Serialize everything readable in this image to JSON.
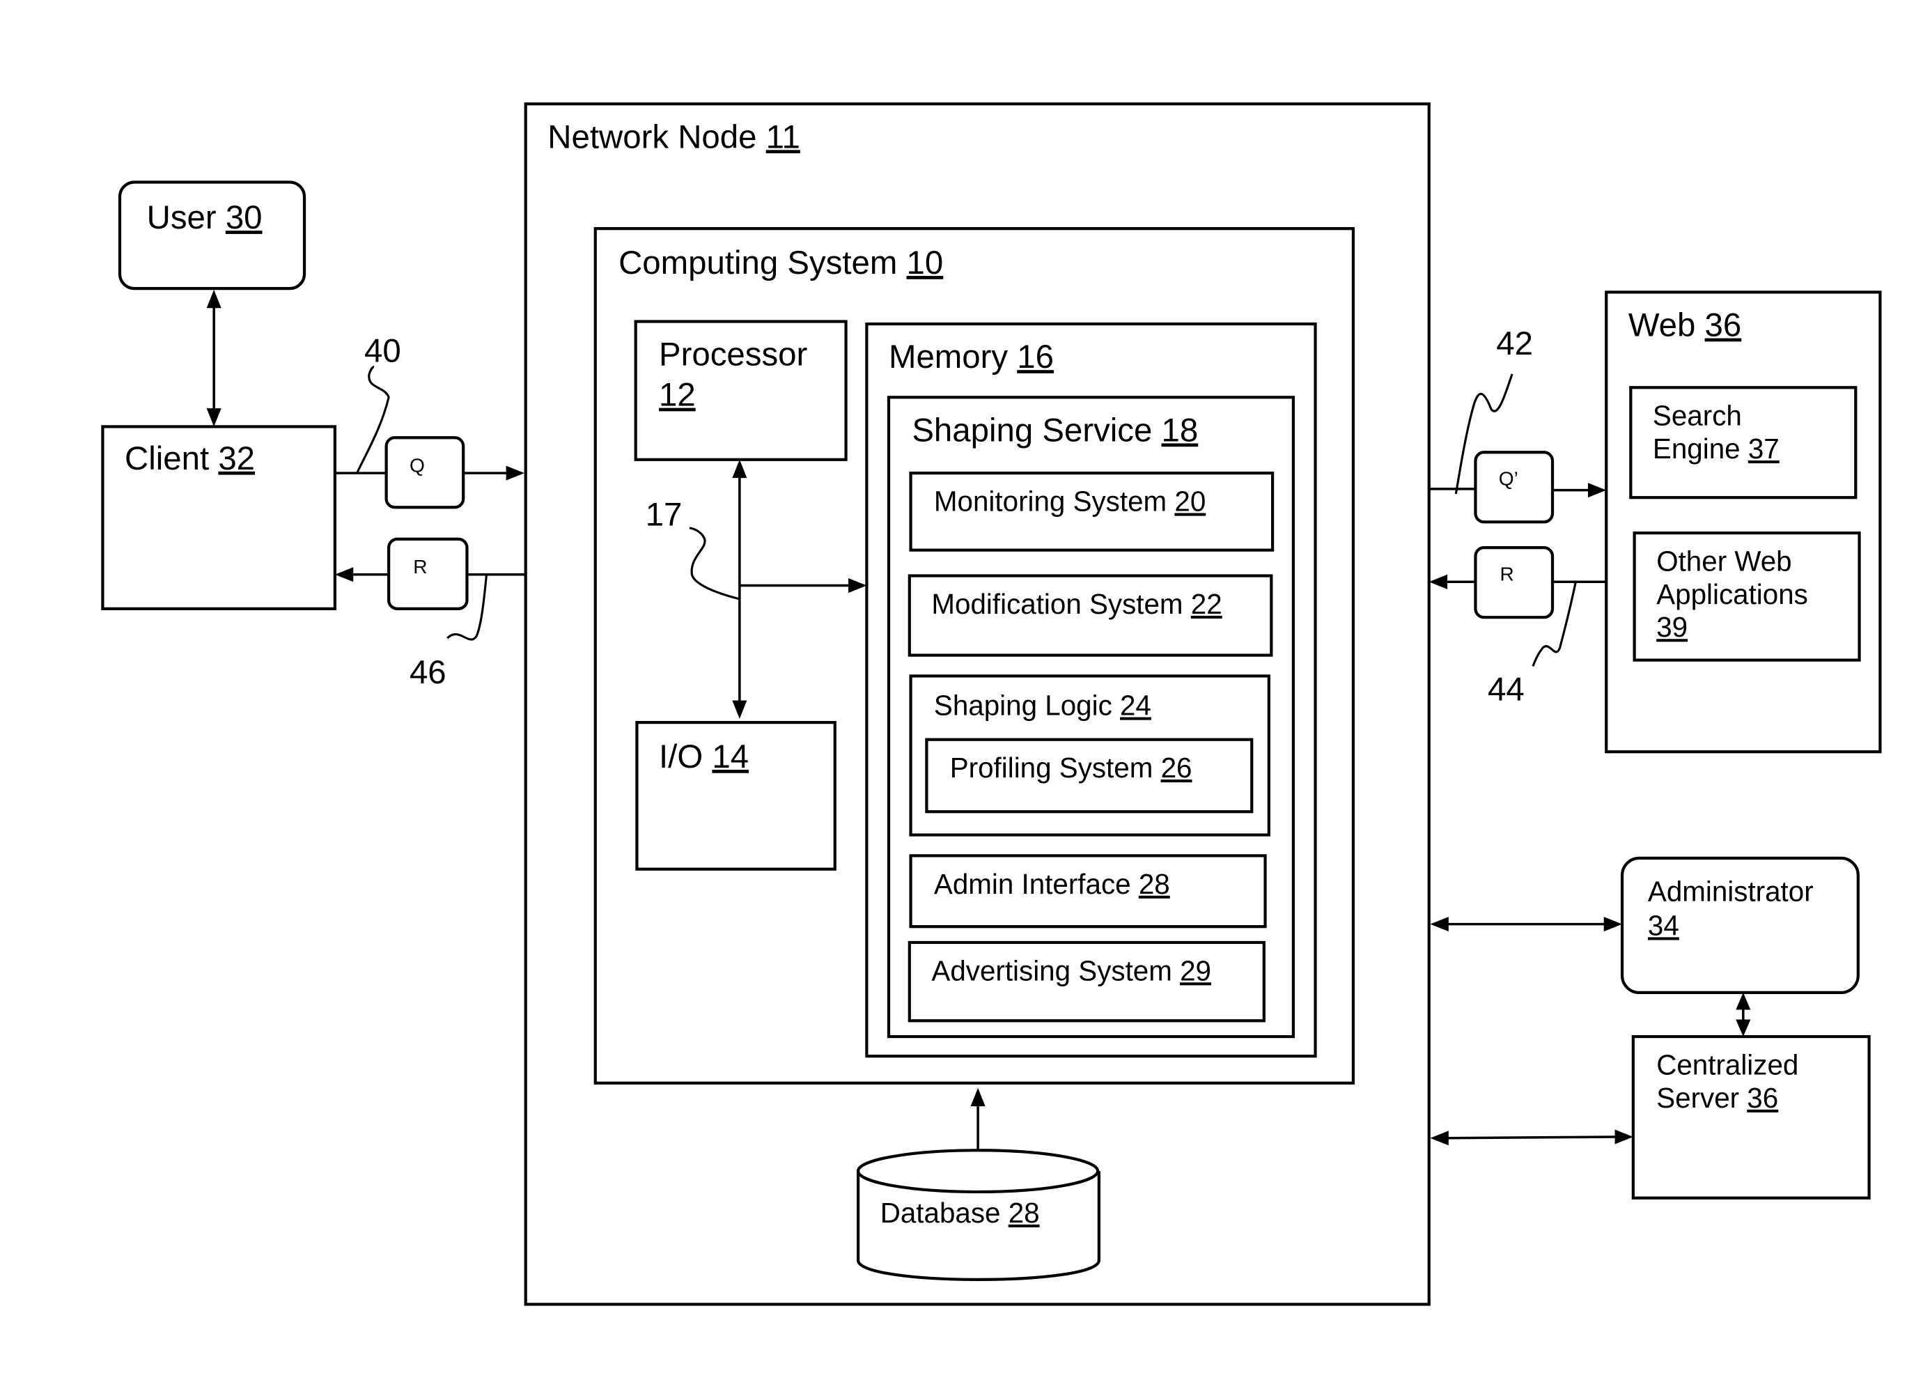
{
  "diagram": {
    "network_node": {
      "name": "Network Node",
      "ref": "11"
    },
    "computing_system": {
      "name": "Computing System",
      "ref": "10"
    },
    "processor": {
      "name": "Processor",
      "ref": "12"
    },
    "io": {
      "name": "I/O",
      "ref": "14"
    },
    "memory": {
      "name": "Memory",
      "ref": "16"
    },
    "bus_ref": "17",
    "shaping_service": {
      "name": "Shaping Service",
      "ref": "18"
    },
    "monitoring_system": {
      "name": "Monitoring System",
      "ref": "20"
    },
    "modification_system": {
      "name": "Modification System",
      "ref": "22"
    },
    "shaping_logic": {
      "name": "Shaping Logic",
      "ref": "24"
    },
    "profiling_system": {
      "name": "Profiling System",
      "ref": "26"
    },
    "admin_interface": {
      "name": "Admin Interface",
      "ref": "28"
    },
    "advertising_system": {
      "name": "Advertising System",
      "ref": "29"
    },
    "database": {
      "name": "Database",
      "ref": "28"
    },
    "user": {
      "name": "User",
      "ref": "30"
    },
    "client": {
      "name": "Client",
      "ref": "32"
    },
    "web": {
      "name": "Web",
      "ref": "36"
    },
    "search_engine": {
      "line1": "Search",
      "line2": "Engine",
      "ref": "37"
    },
    "other_web_apps": {
      "line1": "Other Web",
      "line2": "Applications",
      "ref": "39"
    },
    "administrator": {
      "name": "Administrator",
      "ref": "34"
    },
    "centralized_server": {
      "line1": "Centralized",
      "line2": "Server",
      "ref": "36"
    },
    "packets": {
      "client_query": "Q",
      "client_response": "R",
      "web_query": "Q’",
      "web_response": "R"
    },
    "leader_refs": {
      "client_query_path": "40",
      "web_query_path": "42",
      "web_response_path": "44",
      "client_response_path": "46"
    }
  }
}
